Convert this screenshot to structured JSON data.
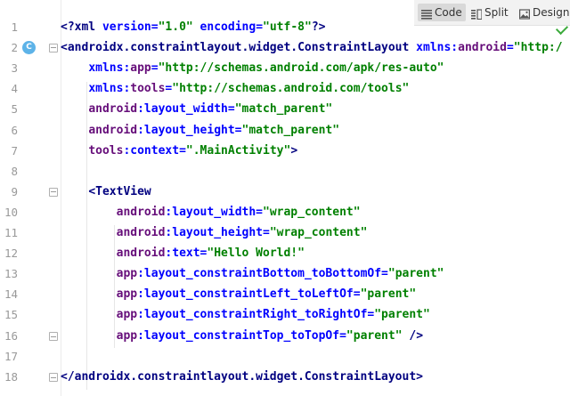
{
  "toolbar": {
    "code_label": "Code",
    "split_label": "Split",
    "design_label": "Design",
    "active": "Code"
  },
  "colors": {
    "tag": "#000080",
    "attribute": "#0000ff",
    "namespace": "#660e7a",
    "value": "#008000",
    "badge": "#5db3e8",
    "check": "#3cab3c"
  },
  "gutter": {
    "class_badge": "C"
  },
  "lines": [
    {
      "n": "1",
      "tokens": [
        {
          "c": "t-tag",
          "t": "<?xml "
        },
        {
          "c": "t-attr",
          "t": "version"
        },
        {
          "c": "t-attr",
          "t": "="
        },
        {
          "c": "t-val",
          "t": "\"1.0\""
        },
        {
          "c": "t-attr",
          "t": " encoding"
        },
        {
          "c": "t-attr",
          "t": "="
        },
        {
          "c": "t-val",
          "t": "\"utf-8\""
        },
        {
          "c": "t-tag",
          "t": "?>"
        }
      ]
    },
    {
      "n": "2",
      "tokens": [
        {
          "c": "t-tag",
          "t": "<androidx.constraintlayout.widget.ConstraintLayout "
        },
        {
          "c": "t-attr",
          "t": "xmlns:"
        },
        {
          "c": "t-ns",
          "t": "android"
        },
        {
          "c": "t-attr",
          "t": "="
        },
        {
          "c": "t-val",
          "t": "\"http:/"
        }
      ]
    },
    {
      "n": "3",
      "tokens": [
        {
          "c": "t-plain",
          "t": "    "
        },
        {
          "c": "t-attr",
          "t": "xmlns:"
        },
        {
          "c": "t-ns",
          "t": "app"
        },
        {
          "c": "t-attr",
          "t": "="
        },
        {
          "c": "t-val",
          "t": "\"http://schemas.android.com/apk/res-auto\""
        }
      ]
    },
    {
      "n": "4",
      "tokens": [
        {
          "c": "t-plain",
          "t": "    "
        },
        {
          "c": "t-attr",
          "t": "xmlns:"
        },
        {
          "c": "t-ns",
          "t": "tools"
        },
        {
          "c": "t-attr",
          "t": "="
        },
        {
          "c": "t-val",
          "t": "\"http://schemas.android.com/tools\""
        }
      ]
    },
    {
      "n": "5",
      "tokens": [
        {
          "c": "t-plain",
          "t": "    "
        },
        {
          "c": "t-ns",
          "t": "android"
        },
        {
          "c": "t-attr",
          "t": ":layout_width="
        },
        {
          "c": "t-val",
          "t": "\"match_parent\""
        }
      ]
    },
    {
      "n": "6",
      "tokens": [
        {
          "c": "t-plain",
          "t": "    "
        },
        {
          "c": "t-ns",
          "t": "android"
        },
        {
          "c": "t-attr",
          "t": ":layout_height="
        },
        {
          "c": "t-val",
          "t": "\"match_parent\""
        }
      ]
    },
    {
      "n": "7",
      "tokens": [
        {
          "c": "t-plain",
          "t": "    "
        },
        {
          "c": "t-ns",
          "t": "tools"
        },
        {
          "c": "t-attr",
          "t": ":context="
        },
        {
          "c": "t-val",
          "t": "\".MainActivity\""
        },
        {
          "c": "t-tag",
          "t": ">"
        }
      ]
    },
    {
      "n": "8",
      "tokens": []
    },
    {
      "n": "9",
      "tokens": [
        {
          "c": "t-plain",
          "t": "    "
        },
        {
          "c": "t-tag",
          "t": "<TextView"
        }
      ]
    },
    {
      "n": "10",
      "tokens": [
        {
          "c": "t-plain",
          "t": "        "
        },
        {
          "c": "t-ns",
          "t": "android"
        },
        {
          "c": "t-attr",
          "t": ":layout_width="
        },
        {
          "c": "t-val",
          "t": "\"wrap_content\""
        }
      ]
    },
    {
      "n": "11",
      "tokens": [
        {
          "c": "t-plain",
          "t": "        "
        },
        {
          "c": "t-ns",
          "t": "android"
        },
        {
          "c": "t-attr",
          "t": ":layout_height="
        },
        {
          "c": "t-val",
          "t": "\"wrap_content\""
        }
      ]
    },
    {
      "n": "12",
      "tokens": [
        {
          "c": "t-plain",
          "t": "        "
        },
        {
          "c": "t-ns",
          "t": "android"
        },
        {
          "c": "t-attr",
          "t": ":text="
        },
        {
          "c": "t-val",
          "t": "\"Hello World!\""
        }
      ]
    },
    {
      "n": "13",
      "tokens": [
        {
          "c": "t-plain",
          "t": "        "
        },
        {
          "c": "t-ns",
          "t": "app"
        },
        {
          "c": "t-attr",
          "t": ":layout_constraintBottom_toBottomOf="
        },
        {
          "c": "t-val",
          "t": "\"parent\""
        }
      ]
    },
    {
      "n": "14",
      "tokens": [
        {
          "c": "t-plain",
          "t": "        "
        },
        {
          "c": "t-ns",
          "t": "app"
        },
        {
          "c": "t-attr",
          "t": ":layout_constraintLeft_toLeftOf="
        },
        {
          "c": "t-val",
          "t": "\"parent\""
        }
      ]
    },
    {
      "n": "15",
      "tokens": [
        {
          "c": "t-plain",
          "t": "        "
        },
        {
          "c": "t-ns",
          "t": "app"
        },
        {
          "c": "t-attr",
          "t": ":layout_constraintRight_toRightOf="
        },
        {
          "c": "t-val",
          "t": "\"parent\""
        }
      ]
    },
    {
      "n": "16",
      "tokens": [
        {
          "c": "t-plain",
          "t": "        "
        },
        {
          "c": "t-ns",
          "t": "app"
        },
        {
          "c": "t-attr",
          "t": ":layout_constraintTop_toTopOf="
        },
        {
          "c": "t-val",
          "t": "\"parent\""
        },
        {
          "c": "t-tag",
          "t": " />"
        }
      ]
    },
    {
      "n": "17",
      "tokens": []
    },
    {
      "n": "18",
      "tokens": [
        {
          "c": "t-tag",
          "t": "</androidx.constraintlayout.widget.ConstraintLayout>"
        }
      ]
    }
  ]
}
